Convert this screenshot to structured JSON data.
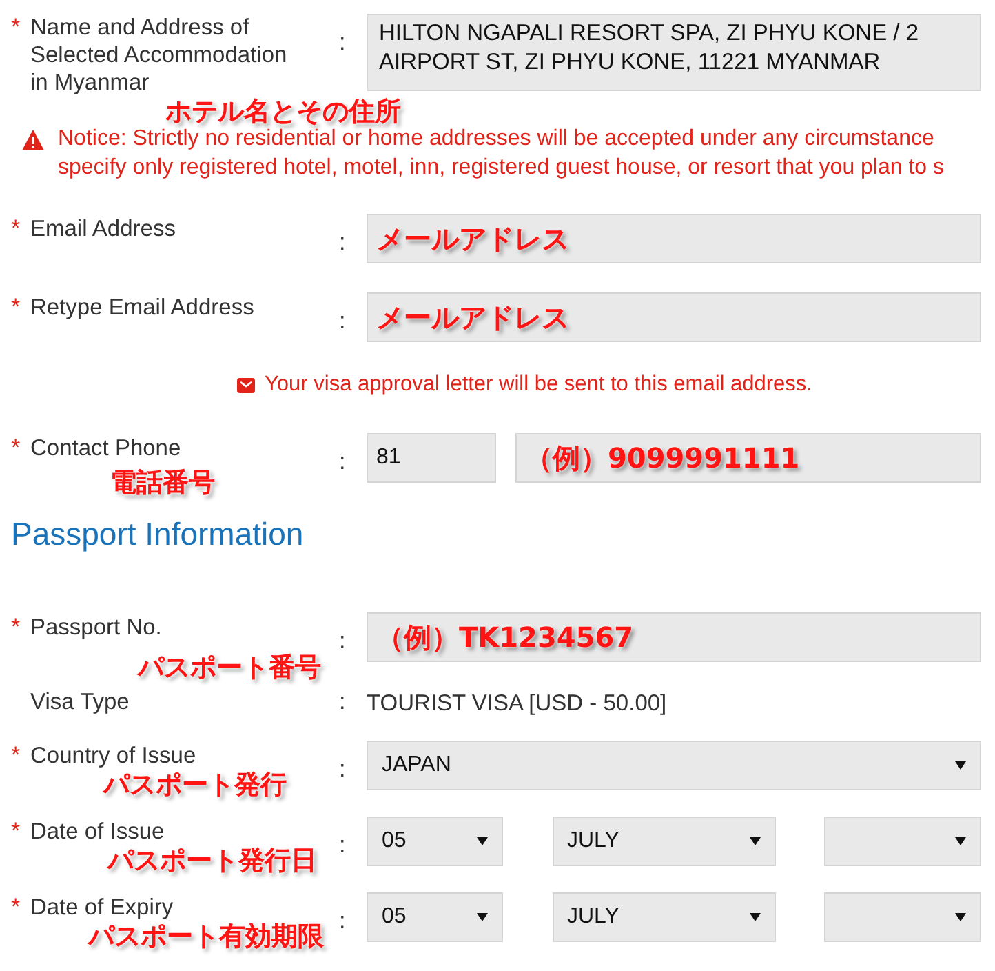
{
  "rows": [
    {
      "kind": "textarea",
      "mark": "*",
      "label": "Name and Address of Selected Accommodation in Myanmar",
      "separator": ":",
      "value": "HILTON NGAPALI RESORT  SPA, ZI PHYU KONE / 2 AIRPORT ST, ZI PHYU KONE, 11221 MYANMAR",
      "annotation": "ホテル名とその住所"
    },
    {
      "kind": "notice",
      "lines": [
        "Notice: Strictly no residential or home addresses will be accepted under any circumstance",
        "specify only registered hotel, motel, inn, registered guest house, or resort that you plan to s"
      ]
    },
    {
      "kind": "input",
      "mark": "*",
      "label": "Email Address",
      "separator": ":",
      "field_annotation": "メールアドレス"
    },
    {
      "kind": "input",
      "mark": "*",
      "label": "Retype Email Address",
      "separator": ":",
      "field_annotation": "メールアドレス"
    },
    {
      "kind": "note",
      "text": "Your visa approval letter will be sent to this email address."
    },
    {
      "kind": "phone",
      "mark": "*",
      "label": "Contact Phone",
      "separator": ":",
      "code": "81",
      "field_annotation": "（例）9099991111",
      "annotation": "電話番号"
    },
    {
      "kind": "heading",
      "text": "Passport Information"
    },
    {
      "kind": "input",
      "mark": "*",
      "label": "Passport No.",
      "separator": ":",
      "field_annotation": "（例）TK1234567",
      "annotation": "パスポート番号"
    },
    {
      "kind": "static",
      "label": "Visa Type",
      "separator": ":",
      "value": "TOURIST VISA [USD - 50.00]"
    },
    {
      "kind": "select",
      "mark": "*",
      "label": "Country of Issue",
      "separator": ":",
      "value": "JAPAN",
      "annotation": "パスポート発行"
    },
    {
      "kind": "date",
      "mark": "*",
      "label": "Date of Issue",
      "separator": ":",
      "day": "05",
      "month": "JULY",
      "annotation": "パスポート発行日"
    },
    {
      "kind": "date",
      "mark": "*",
      "label": "Date of Expiry",
      "separator": ":",
      "day": "05",
      "month": "JULY",
      "annotation": "パスポート有効期限"
    }
  ]
}
